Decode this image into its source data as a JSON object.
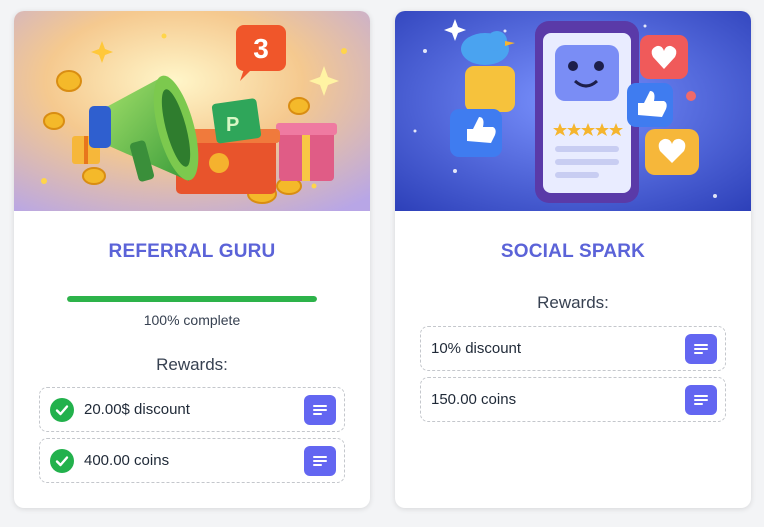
{
  "colors": {
    "accent": "#6366f1",
    "title": "#5b63d8",
    "success": "#22b14c",
    "progress": "#2db34a"
  },
  "cards": [
    {
      "title": "REFERRAL GURU",
      "banner_icon": "megaphone-gift-coins-illustration",
      "banner_badge": "3",
      "progress": {
        "percent": 100,
        "text": "100% complete"
      },
      "rewards_label": "Rewards:",
      "rewards": [
        {
          "text": "20.00$ discount",
          "completed": true
        },
        {
          "text": "400.00 coins",
          "completed": true
        }
      ]
    },
    {
      "title": "SOCIAL SPARK",
      "banner_icon": "smartphone-social-likes-illustration",
      "rewards_label": "Rewards:",
      "rewards": [
        {
          "text": "10% discount",
          "completed": false
        },
        {
          "text": "150.00 coins",
          "completed": false
        }
      ]
    }
  ]
}
